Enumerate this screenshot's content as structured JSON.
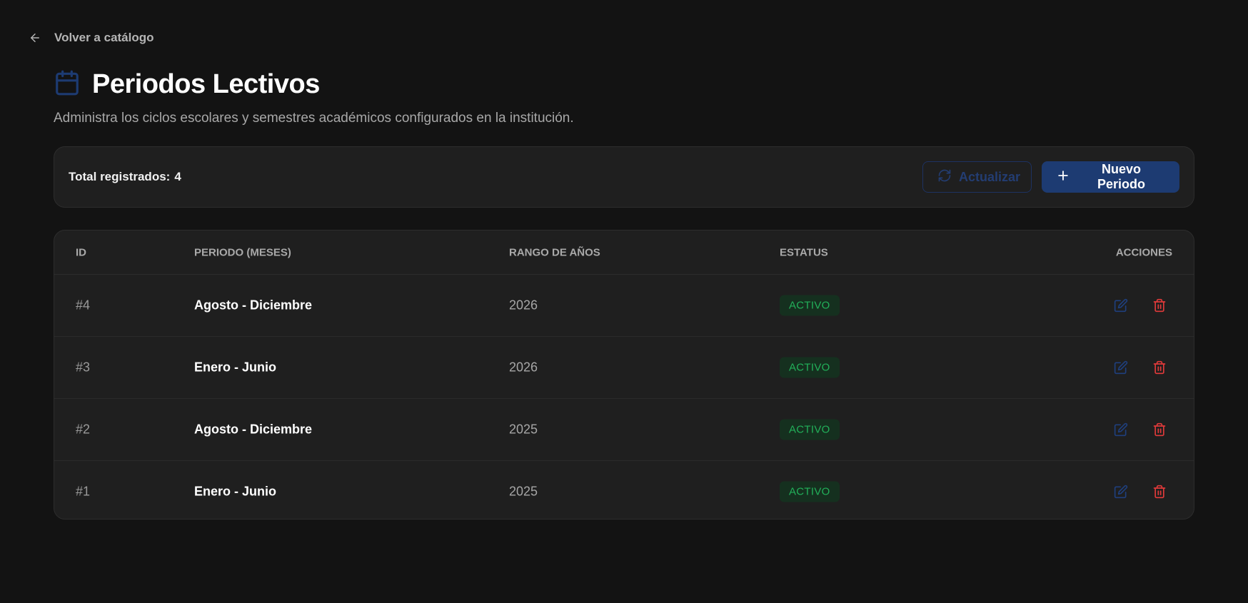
{
  "nav": {
    "back_label": "Volver a catálogo",
    "back_icon": "arrow-left-icon"
  },
  "header": {
    "title": "Periodos Lectivos",
    "title_icon": "calendar-icon",
    "subtitle": "Administra los ciclos escolares y semestres académicos configurados en la institución."
  },
  "toolbar": {
    "total_label": "Total registrados:",
    "total_value": "4",
    "refresh_label": "Actualizar",
    "refresh_icon": "refresh-icon",
    "new_label": "Nuevo Periodo",
    "new_icon": "plus-icon"
  },
  "table": {
    "columns": {
      "id": "ID",
      "period": "PERIODO (MESES)",
      "range": "RANGO DE AÑOS",
      "status": "ESTATUS",
      "actions": "ACCIONES"
    },
    "rows": [
      {
        "id": "#4",
        "period": "Agosto - Diciembre",
        "range": "2026",
        "status": "ACTIVO"
      },
      {
        "id": "#3",
        "period": "Enero - Junio",
        "range": "2026",
        "status": "ACTIVO"
      },
      {
        "id": "#2",
        "period": "Agosto - Diciembre",
        "range": "2025",
        "status": "ACTIVO"
      },
      {
        "id": "#1",
        "period": "Enero - Junio",
        "range": "2025",
        "status": "ACTIVO"
      }
    ],
    "row_icons": {
      "edit": "edit-icon",
      "delete": "trash-icon"
    }
  },
  "colors": {
    "background": "#131313",
    "card": "#1f1f1f",
    "accent": "#1d3b72",
    "active_badge_text": "#22b05a",
    "active_badge_bg": "#15301f",
    "delete": "#e03a3a"
  }
}
